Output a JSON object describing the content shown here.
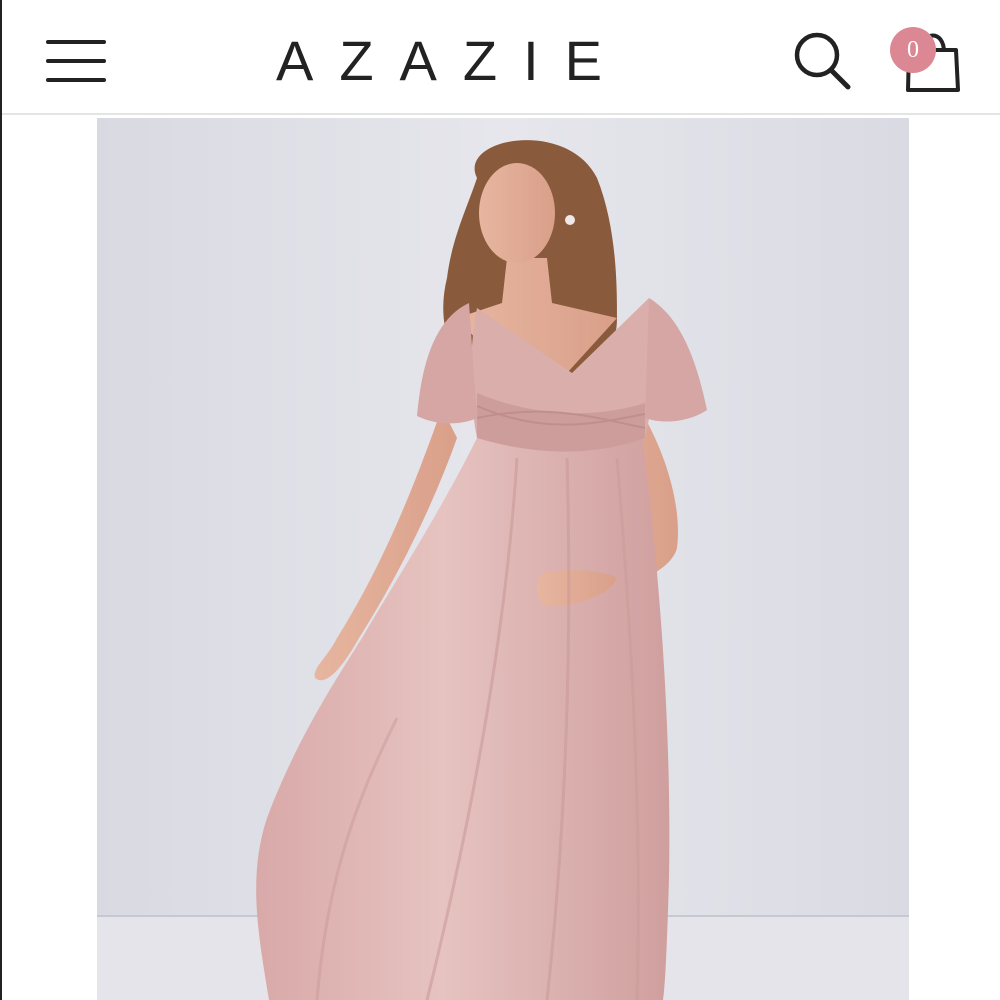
{
  "header": {
    "brand": "AZAZIE",
    "cart_count": "0",
    "icons": {
      "menu": "hamburger-menu-icon",
      "search": "search-icon",
      "cart": "shopping-bag-icon"
    }
  },
  "colors": {
    "badge": "#dc8894",
    "text": "#222222",
    "dress": "#dcb0ae",
    "backdrop": "#dcdce6"
  }
}
